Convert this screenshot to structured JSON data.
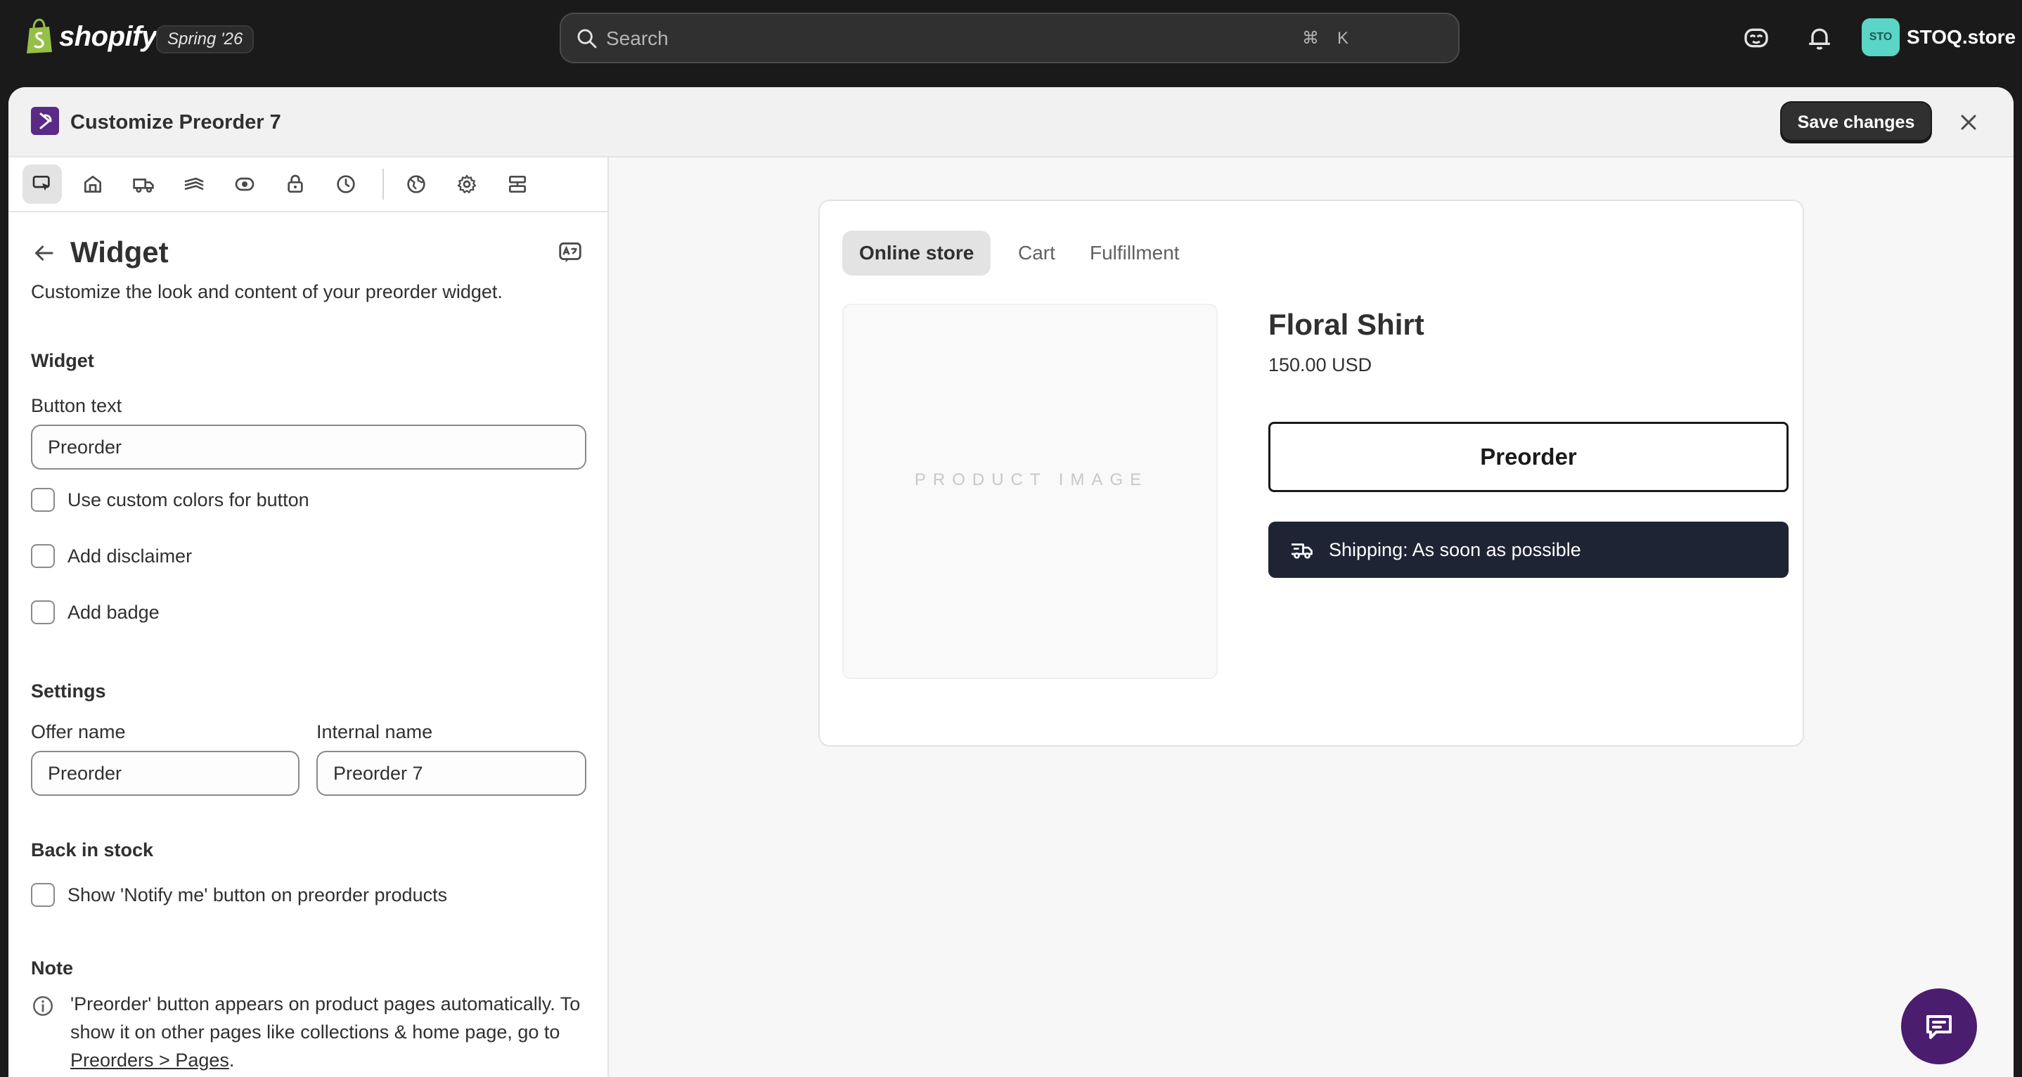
{
  "topbar": {
    "brand": "shopify",
    "season_badge": "Spring '26",
    "search_placeholder": "Search",
    "shortcut_cmd": "⌘",
    "shortcut_key": "K",
    "avatar_initials": "STO",
    "store_name": "STOQ.store"
  },
  "modal": {
    "title": "Customize Preorder 7",
    "save_label": "Save changes"
  },
  "toolbar": {
    "icons": [
      "widget-icon",
      "store-icon",
      "shipping-icon",
      "payment-icon",
      "visibility-icon",
      "lock-icon",
      "clock-icon",
      "globe-icon",
      "gear-icon",
      "layout-icon"
    ],
    "active_index": 0
  },
  "panel": {
    "title": "Widget",
    "description": "Customize the look and content of your preorder widget.",
    "widget_section": "Widget",
    "button_text_label": "Button text",
    "button_text_value": "Preorder",
    "custom_colors_label": "Use custom colors for button",
    "disclaimer_label": "Add disclaimer",
    "badge_label": "Add badge",
    "settings_section": "Settings",
    "offer_name_label": "Offer name",
    "offer_name_value": "Preorder",
    "internal_name_label": "Internal name",
    "internal_name_value": "Preorder 7",
    "back_in_stock_section": "Back in stock",
    "notify_label": "Show 'Notify me' button on preorder products",
    "note_section": "Note",
    "note_text": "'Preorder' button appears on product pages automatically. To show it on other pages like collections & home page, go to ",
    "note_link": "Preorders > Pages",
    "note_end": "."
  },
  "preview": {
    "tabs": [
      "Online store",
      "Cart",
      "Fulfillment"
    ],
    "active_tab": "Online store",
    "image_placeholder": "PRODUCT IMAGE",
    "product_title": "Floral Shirt",
    "product_price": "150.00 USD",
    "preorder_button": "Preorder",
    "shipping_text": "Shipping: As soon as possible"
  },
  "colors": {
    "topbar_bg": "#1a1a1a",
    "avatar_bg": "#5ad5c6",
    "app_icon": "#5b2a86",
    "shipping_bar": "#1e2433",
    "chat_bubble": "#4a1d6e"
  }
}
